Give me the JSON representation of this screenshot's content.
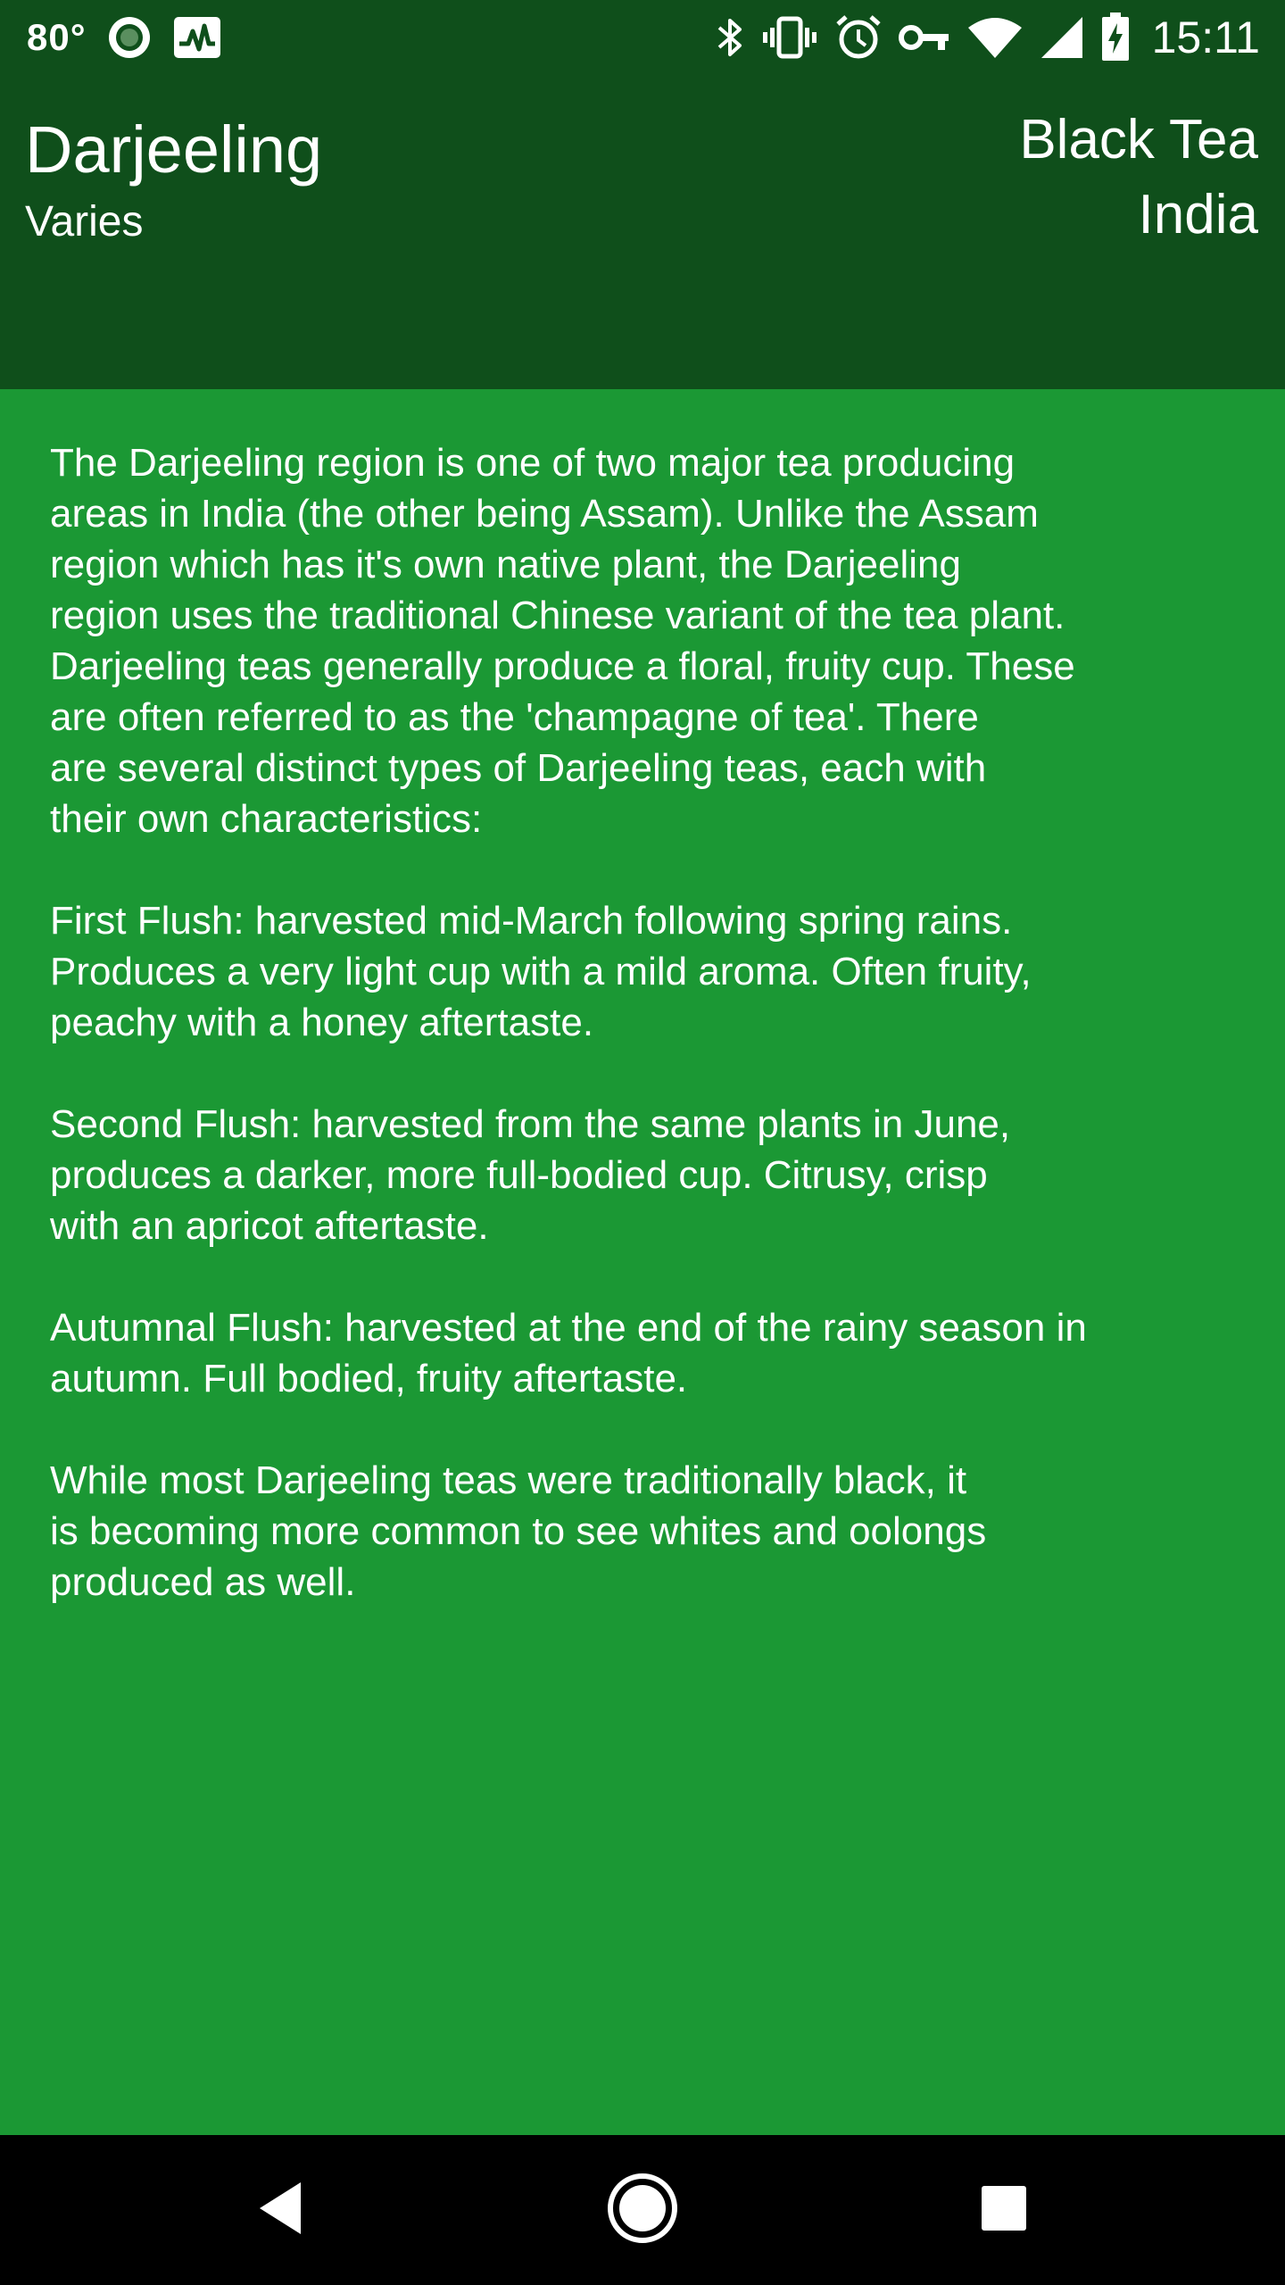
{
  "status_bar": {
    "temperature": "80°",
    "time": "15:11",
    "icons": [
      "circle-record-icon",
      "activity-chart-icon",
      "bluetooth-icon",
      "vibrate-icon",
      "alarm-icon",
      "vpn-key-icon",
      "wifi-icon",
      "cell-signal-icon",
      "battery-charging-icon"
    ]
  },
  "header": {
    "name": "Darjeeling",
    "temperature": "Varies",
    "type": "Black Tea",
    "origin": "India",
    "background_color": "#0f4f1b"
  },
  "content": {
    "background_color": "#1b9834",
    "paragraphs": [
      "The Darjeeling region is one of two major tea producing\nareas in India (the other being Assam). Unlike the Assam\nregion which has it's own native plant, the Darjeeling\nregion uses the traditional Chinese variant of the tea plant.\nDarjeeling teas generally produce a floral, fruity cup. These\nare often referred to as the 'champagne of tea'. There\nare several distinct types of Darjeeling teas, each with\ntheir own characteristics:",
      "First Flush: harvested mid-March following spring rains.\nProduces a very light cup with a mild aroma. Often fruity,\npeachy with a honey aftertaste.",
      "Second Flush: harvested from the same plants in June,\nproduces a darker, more full-bodied cup. Citrusy, crisp\nwith an apricot aftertaste.",
      "Autumnal Flush: harvested at the end of the rainy season in\nautumn. Full bodied, fruity aftertaste.",
      "While most Darjeeling teas were traditionally black, it\nis becoming more common to see whites and oolongs\nproduced as well."
    ]
  },
  "nav_bar": {
    "buttons": [
      "back-icon",
      "home-icon",
      "recents-icon"
    ]
  }
}
